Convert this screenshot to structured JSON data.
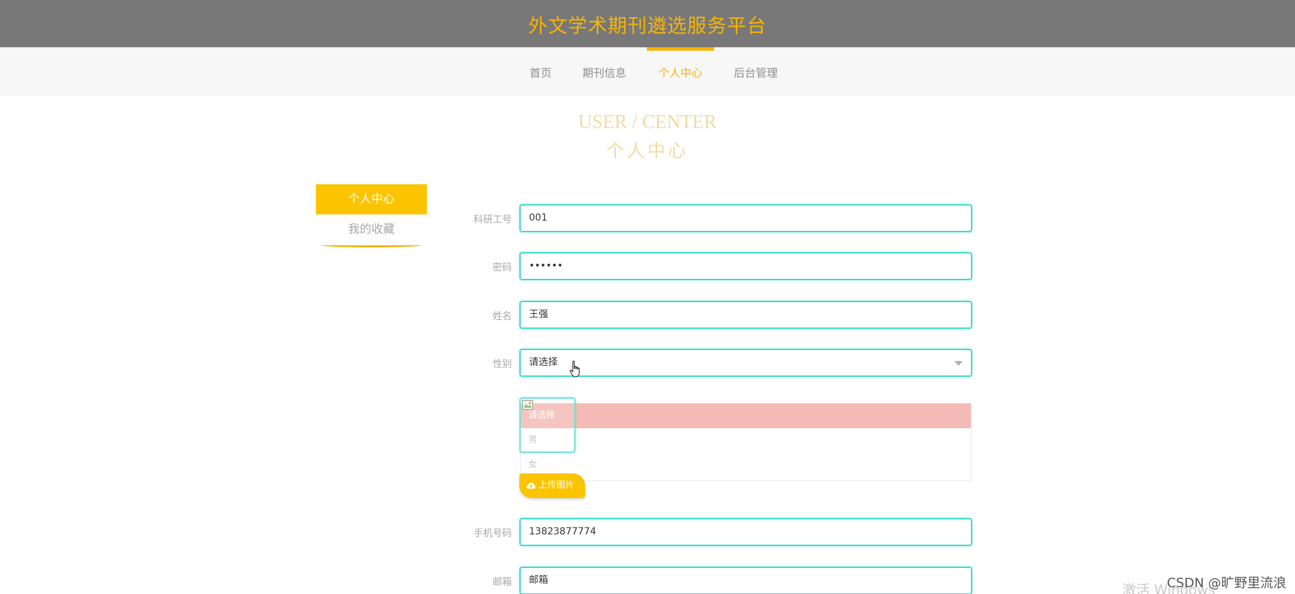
{
  "header": {
    "title": "外文学术期刊遴选服务平台"
  },
  "nav": {
    "items": [
      {
        "label": "首页"
      },
      {
        "label": "期刊信息"
      },
      {
        "label": "个人中心"
      },
      {
        "label": "后台管理"
      }
    ],
    "active": "个人中心"
  },
  "page_heading": {
    "en": "USER / CENTER",
    "cn": "个人中心"
  },
  "side_menu": {
    "items": [
      {
        "label": "个人中心"
      },
      {
        "label": "我的收藏"
      }
    ],
    "active": "个人中心"
  },
  "form": {
    "id": {
      "label": "科研工号",
      "value": "001"
    },
    "password": {
      "label": "密码",
      "value": "••••••"
    },
    "name": {
      "label": "姓名",
      "value": "王强"
    },
    "gender": {
      "label": "性别",
      "value": "请选择",
      "options": [
        "请选择",
        "男",
        "女"
      ]
    },
    "upload_button": "上传图片",
    "phone": {
      "label": "手机号码",
      "value": "13823877774"
    },
    "email": {
      "label": "邮箱",
      "value": "邮箱"
    }
  },
  "watermark": {
    "windows": "激活 Windows",
    "csdn": "CSDN @旷野里流浪"
  },
  "colors": {
    "topbar_bg": "#787878",
    "accent": "#f8b400",
    "field_border": "#3ed9c8",
    "selected_option_bg": "#f4bbb6",
    "heading": "#efdca0"
  },
  "icons": [
    "hand-pointer-icon",
    "broken-image-icon",
    "cloud-upload-icon",
    "chevron-down-icon"
  ]
}
